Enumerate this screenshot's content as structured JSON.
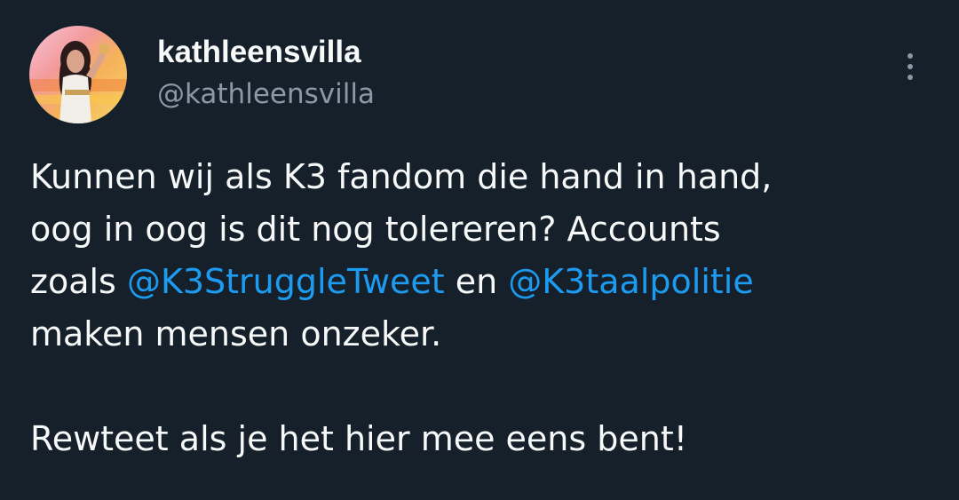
{
  "author": {
    "display_name": "kathleensvilla",
    "handle": "@kathleensvilla",
    "avatar_icon": "profile-photo"
  },
  "more_icon": "vertical-ellipsis-icon",
  "tweet": {
    "line1": "Kunnen wij als K3 fandom die hand in hand,",
    "line2": "oog in oog is dit nog tolereren? Accounts",
    "line3_prefix": "zoals",
    "mention1": "@K3StruggleTweet",
    "line3_mid": "en",
    "mention2": "@K3taalpolitie",
    "line4": "maken mensen onzeker.",
    "line6": "Rewteet als je het hier mee eens bent!"
  },
  "colors": {
    "background": "#15202b",
    "text": "#f7f9f9",
    "secondary": "#8b98a5",
    "link": "#1d9bf0"
  }
}
